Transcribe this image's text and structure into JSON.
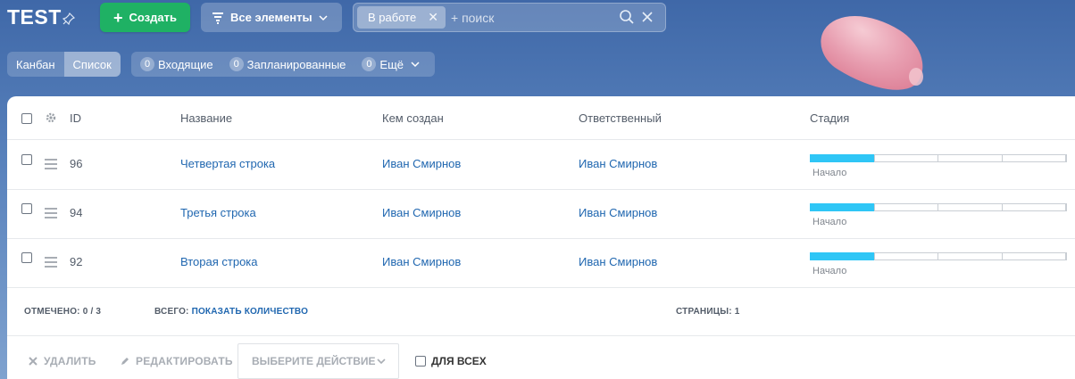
{
  "header": {
    "title": "TEST",
    "create_label": "Создать",
    "all_items_label": "Все элементы",
    "filter_chip": "В работе",
    "search_placeholder": "+ поиск"
  },
  "view": {
    "kanban_label": "Канбан",
    "list_label": "Список",
    "active": "Список"
  },
  "counters": [
    {
      "count": "0",
      "label": "Входящие"
    },
    {
      "count": "0",
      "label": "Запланированные"
    },
    {
      "count": "0",
      "label": "Ещё"
    }
  ],
  "table": {
    "columns": [
      "ID",
      "Название",
      "Кем создан",
      "Ответственный",
      "Стадия"
    ],
    "rows": [
      {
        "id": "96",
        "name": "Четвертая строка",
        "created_by": "Иван Смирнов",
        "responsible": "Иван Смирнов",
        "stage": "Начало",
        "stage_progress": 0.25
      },
      {
        "id": "94",
        "name": "Третья строка",
        "created_by": "Иван Смирнов",
        "responsible": "Иван Смирнов",
        "stage": "Начало",
        "stage_progress": 0.25
      },
      {
        "id": "92",
        "name": "Вторая строка",
        "created_by": "Иван Смирнов",
        "responsible": "Иван Смирнов",
        "stage": "Начало",
        "stage_progress": 0.25
      }
    ]
  },
  "footer": {
    "selected_label": "ОТМЕЧЕНО:",
    "selected_value": "0 / 3",
    "total_label": "ВСЕГО:",
    "total_link": "ПОКАЗАТЬ КОЛИЧЕСТВО",
    "pages_label": "СТРАНИЦЫ:",
    "pages_value": "1"
  },
  "actions": {
    "delete_label": "УДАЛИТЬ",
    "edit_label": "РЕДАКТИРОВАТЬ",
    "select_action_label": "ВЫБЕРИТЕ ДЕЙСТВИЕ",
    "for_all_label": "ДЛЯ ВСЕХ"
  },
  "colors": {
    "create_button": "#1fb164",
    "link": "#2067b0",
    "stage_fill": "#2fc6f6"
  }
}
